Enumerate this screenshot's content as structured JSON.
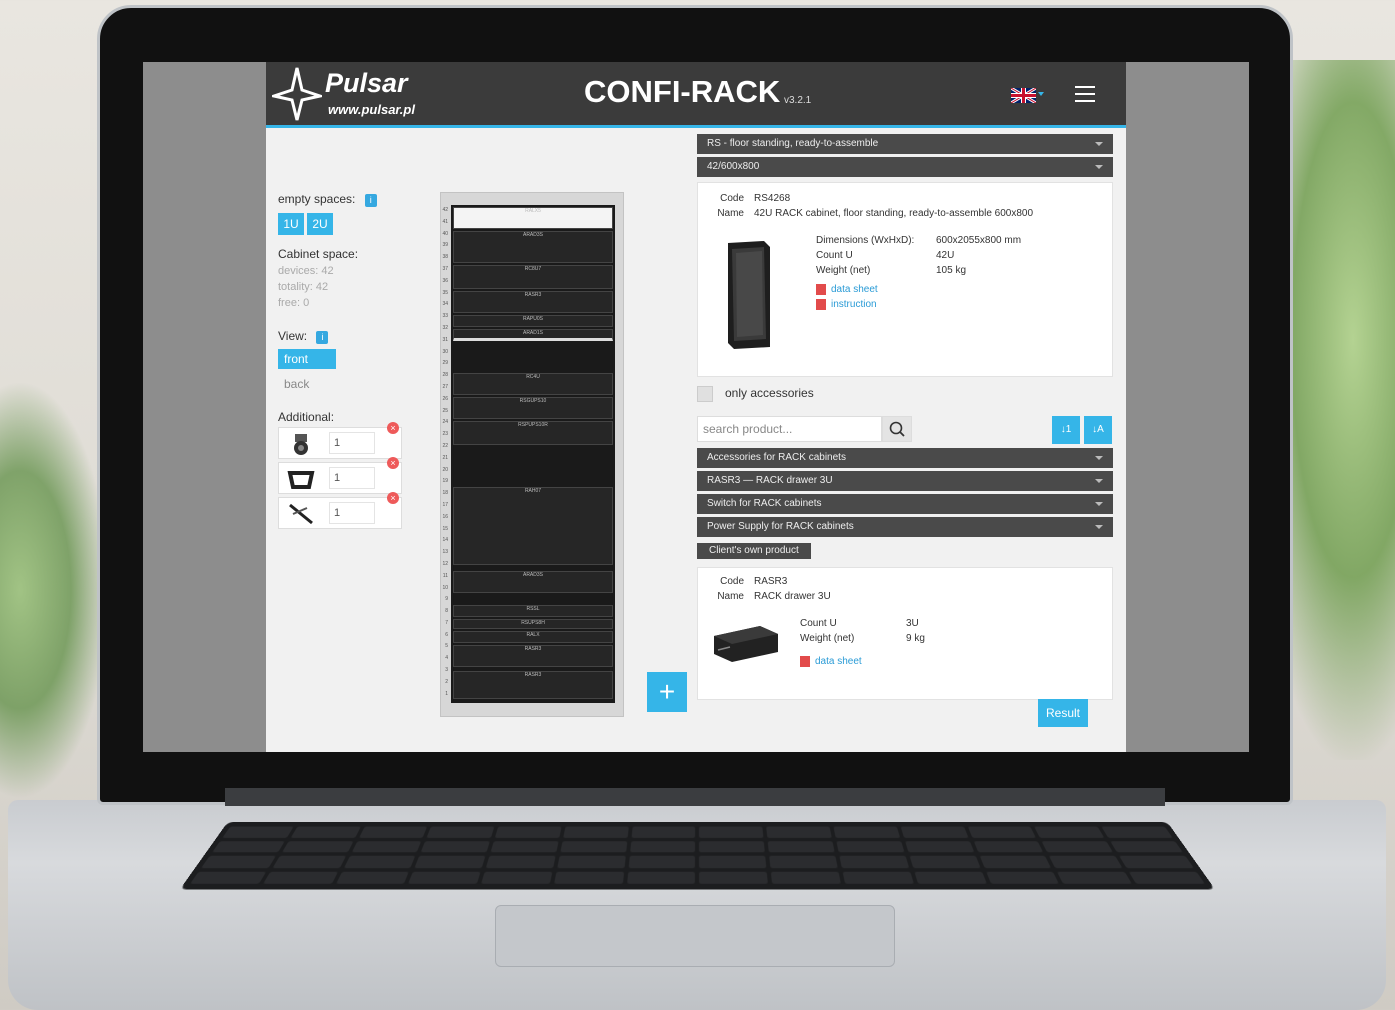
{
  "brand": {
    "name": "Pulsar",
    "url": "www.pulsar.pl"
  },
  "header": {
    "title": "CONFI-RACK",
    "version": "v3.2.1",
    "language_icon": "uk-flag-icon",
    "menu_icon": "hamburger-menu-icon"
  },
  "left": {
    "empty_spaces_label": "empty spaces:",
    "info": "i",
    "u_buttons": [
      "1U",
      "2U"
    ],
    "cabinet_space_label": "Cabinet space:",
    "devices": "devices: 42",
    "totality": "totality: 42",
    "free": "free: 0",
    "view_label": "View:",
    "view_front": "front",
    "view_back": "back",
    "additional_label": "Additional:",
    "additional_items": [
      {
        "qty": "1",
        "icon": "caster-wheel-icon"
      },
      {
        "qty": "1",
        "icon": "frame-icon"
      },
      {
        "qty": "1",
        "icon": "cable-icon"
      }
    ]
  },
  "rack": {
    "numbers": [
      "42",
      "41",
      "40",
      "39",
      "38",
      "37",
      "36",
      "35",
      "34",
      "33",
      "32",
      "31",
      "30",
      "29",
      "28",
      "27",
      "26",
      "25",
      "24",
      "23",
      "22",
      "21",
      "20",
      "19",
      "18",
      "17",
      "16",
      "15",
      "14",
      "13",
      "12",
      "11",
      "10",
      "9",
      "8",
      "7",
      "6",
      "5",
      "4",
      "3",
      "2",
      "1"
    ],
    "units": [
      "RALX5",
      "ARAD3S",
      "RC8U7",
      "RASR3",
      "RAPU0S",
      "ARAD1S",
      "RC4U",
      "RSGUPS10",
      "RSPUPS10R",
      "RAH07",
      "ARAD3S",
      "RSSL",
      "RSUPS8H",
      "RALX",
      "RASR3",
      "RASR3"
    ]
  },
  "plus_button": "+",
  "right": {
    "cabinet_type": "RS - floor standing, ready-to-assemble",
    "cabinet_size": "42/600x800",
    "product1": {
      "code_label": "Code",
      "code": "RS4268",
      "name_label": "Name",
      "name": "42U RACK cabinet, floor standing, ready-to-assemble 600x800",
      "dimensions_label": "Dimensions (WxHxD):",
      "dimensions": "600x2055x800 mm",
      "count_label": "Count U",
      "count": "42U",
      "weight_label": "Weight (net)",
      "weight": "105 kg",
      "datasheet": "data sheet",
      "instruction": "instruction"
    },
    "only_accessories": "only accessories",
    "search_placeholder": "search product...",
    "sort_asc": "↓1",
    "sort_alpha": "↓A",
    "categories": [
      "Accessories for RACK cabinets",
      "RASR3 — RACK drawer 3U",
      "Switch for RACK cabinets",
      "Power Supply for RACK cabinets"
    ],
    "client_own_product": "Client's own product",
    "product2": {
      "code_label": "Code",
      "code": "RASR3",
      "name_label": "Name",
      "name": "RACK drawer 3U",
      "count_label": "Count U",
      "count": "3U",
      "weight_label": "Weight (net)",
      "weight": "9 kg",
      "datasheet": "data sheet"
    },
    "result_button": "Result"
  },
  "colors": {
    "accent": "#35b5e8",
    "header": "#3b3b3b",
    "dropdown": "#4a4a4a",
    "delete": "#ee5a5a"
  }
}
